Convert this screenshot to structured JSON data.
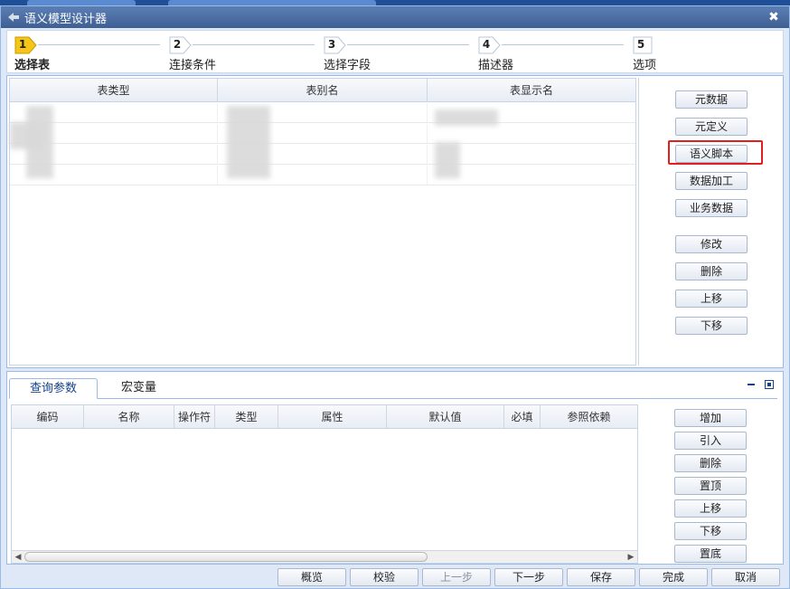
{
  "window": {
    "title": "语义模型设计器",
    "close_label": "✖"
  },
  "wizard": {
    "steps": [
      {
        "num": "1",
        "label": "选择表"
      },
      {
        "num": "2",
        "label": "连接条件"
      },
      {
        "num": "3",
        "label": "选择字段"
      },
      {
        "num": "4",
        "label": "描述器"
      },
      {
        "num": "5",
        "label": "选项"
      }
    ],
    "active_step": 1
  },
  "table_grid": {
    "columns": [
      "表类型",
      "表别名",
      "表显示名"
    ]
  },
  "side_buttons": {
    "meta_data": "元数据",
    "meta_define": "元定义",
    "semantic_script": "语义脚本",
    "data_process": "数据加工",
    "business_data": "业务数据",
    "modify": "修改",
    "delete": "删除",
    "move_up": "上移",
    "move_down": "下移"
  },
  "tabs": {
    "query_params": "查询参数",
    "macro_vars": "宏变量"
  },
  "param_grid": {
    "columns": [
      "编码",
      "名称",
      "操作符",
      "类型",
      "属性",
      "默认值",
      "必填",
      "参照依赖"
    ]
  },
  "param_buttons": {
    "add": "增加",
    "import": "引入",
    "delete": "删除",
    "top": "置顶",
    "up": "上移",
    "down": "下移",
    "bottom": "置底"
  },
  "footer": {
    "overview": "概览",
    "validate": "校验",
    "prev": "上一步",
    "next": "下一步",
    "save": "保存",
    "finish": "完成",
    "cancel": "取消"
  },
  "colors": {
    "accent": "#15428b",
    "highlight": "#e02020",
    "step_active": "#f5c518"
  }
}
